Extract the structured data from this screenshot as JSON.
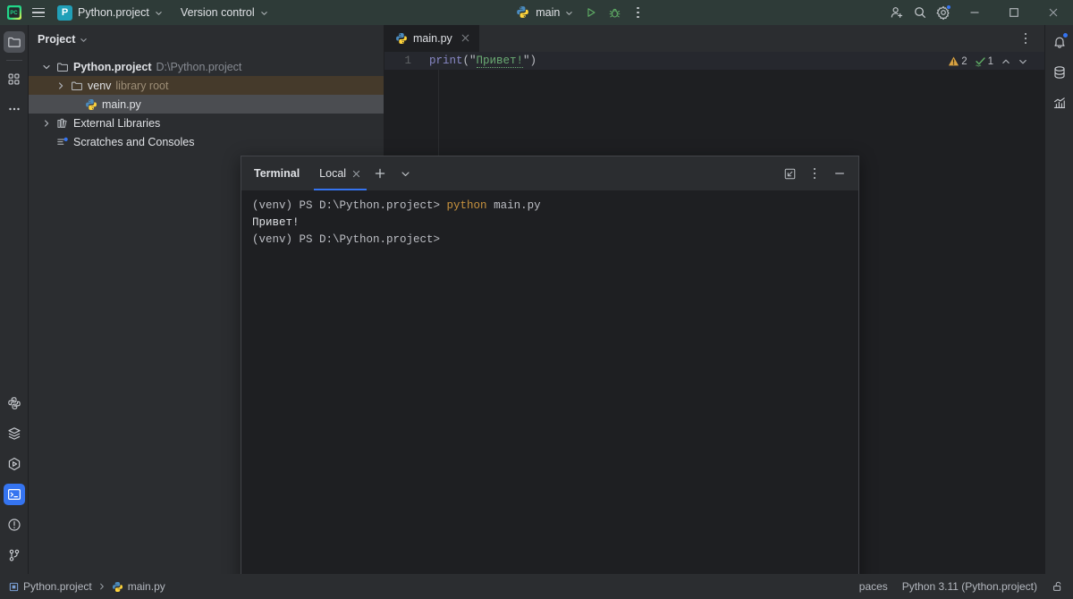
{
  "app": {
    "logo_name": "pycharm-logo",
    "accent_blue": "#3574f0",
    "toolbar_bg": "#2e3b38",
    "panel_bg": "#2b2d30",
    "editor_bg": "#1e1f22"
  },
  "toolbar": {
    "menu_label": "main-menu",
    "project_badge": "P",
    "project_name": "Python.project",
    "version_control": "Version control",
    "run_config": "main",
    "run_button": "run-button",
    "debug_button": "debug-button",
    "more_button": "more-actions",
    "account_button": "account",
    "search_button": "search-everywhere",
    "settings_button": "settings",
    "minimize": "minimize",
    "maximize": "maximize",
    "close": "close"
  },
  "left_rail": {
    "top": [
      {
        "name": "project-tool-window",
        "icon": "folder-icon",
        "selected": true
      },
      {
        "name": "structure-tool-window",
        "icon": "structure-icon",
        "selected": false
      },
      {
        "name": "more-tool-windows",
        "icon": "ellipsis-icon",
        "selected": false
      }
    ],
    "bottom": [
      {
        "name": "python-console",
        "icon": "python-icon",
        "selected": false
      },
      {
        "name": "python-packages",
        "icon": "layers-icon",
        "selected": false
      },
      {
        "name": "run-tool-window",
        "icon": "play-hex-icon",
        "selected": false
      },
      {
        "name": "terminal-tool-window",
        "icon": "terminal-icon",
        "selected": true
      },
      {
        "name": "problems-tool-window",
        "icon": "warning-circle-icon",
        "selected": false
      },
      {
        "name": "version-control-tool-window",
        "icon": "branch-icon",
        "selected": false
      }
    ]
  },
  "right_rail": [
    {
      "name": "notifications",
      "icon": "bell-icon",
      "badge": true
    },
    {
      "name": "database",
      "icon": "database-icon",
      "badge": false
    },
    {
      "name": "profiler",
      "icon": "chart-icon",
      "badge": false
    }
  ],
  "project_panel": {
    "title": "Project",
    "tree": [
      {
        "name": "project-root",
        "label": "Python.project",
        "sub": "D:\\Python.project",
        "icon": "folder-icon",
        "arrow": "expanded",
        "depth": 0,
        "bold": true,
        "state": "normal"
      },
      {
        "name": "venv-folder",
        "label": "venv",
        "sub": "library root",
        "icon": "folder-icon",
        "arrow": "collapsed",
        "depth": 1,
        "bold": false,
        "state": "venv"
      },
      {
        "name": "main-py-file",
        "label": "main.py",
        "sub": "",
        "icon": "python-icon",
        "arrow": "none",
        "depth": 2,
        "bold": false,
        "state": "selected"
      },
      {
        "name": "external-libraries",
        "label": "External Libraries",
        "sub": "",
        "icon": "library-icon",
        "arrow": "collapsed",
        "depth": 0,
        "bold": false,
        "state": "normal"
      },
      {
        "name": "scratches-and-consoles",
        "label": "Scratches and Consoles",
        "sub": "",
        "icon": "scratches-icon",
        "arrow": "none",
        "depth": 0,
        "bold": false,
        "state": "normal"
      }
    ]
  },
  "editor": {
    "tab_label": "main.py",
    "tab_icon": "python-icon",
    "line_number": "1",
    "code": {
      "fn": "print",
      "open_paren": "(\"",
      "string": "Привет!",
      "close_paren": "\")"
    },
    "inspections": {
      "warning_count": "2",
      "ok_count": "1",
      "prev_button": "previous-highlight",
      "next_button": "next-highlight"
    }
  },
  "terminal": {
    "title": "Terminal",
    "tab_label": "Local",
    "close_tab": "close-tab",
    "new_tab": "new-terminal-tab",
    "tab_options": "terminal-tab-options",
    "move_to_editor": "move-to-editor",
    "options": "terminal-options",
    "minimize": "minimize-terminal",
    "lines": [
      {
        "type": "command",
        "prompt": "(venv) PS D:\\Python.project> ",
        "cmd": "python",
        "arg": " main.py"
      },
      {
        "type": "output",
        "text": "Привет!"
      },
      {
        "type": "prompt",
        "prompt": "(venv) PS D:\\Python.project>"
      }
    ]
  },
  "statusbar": {
    "breadcrumbs": [
      {
        "name": "breadcrumb-project",
        "label": "Python.project",
        "icon": "module-icon"
      },
      {
        "name": "breadcrumb-file",
        "label": "main.py",
        "icon": "python-icon"
      }
    ],
    "indent": "paces",
    "interpreter": "Python 3.11 (Python.project)",
    "lock": "unlocked-icon"
  }
}
